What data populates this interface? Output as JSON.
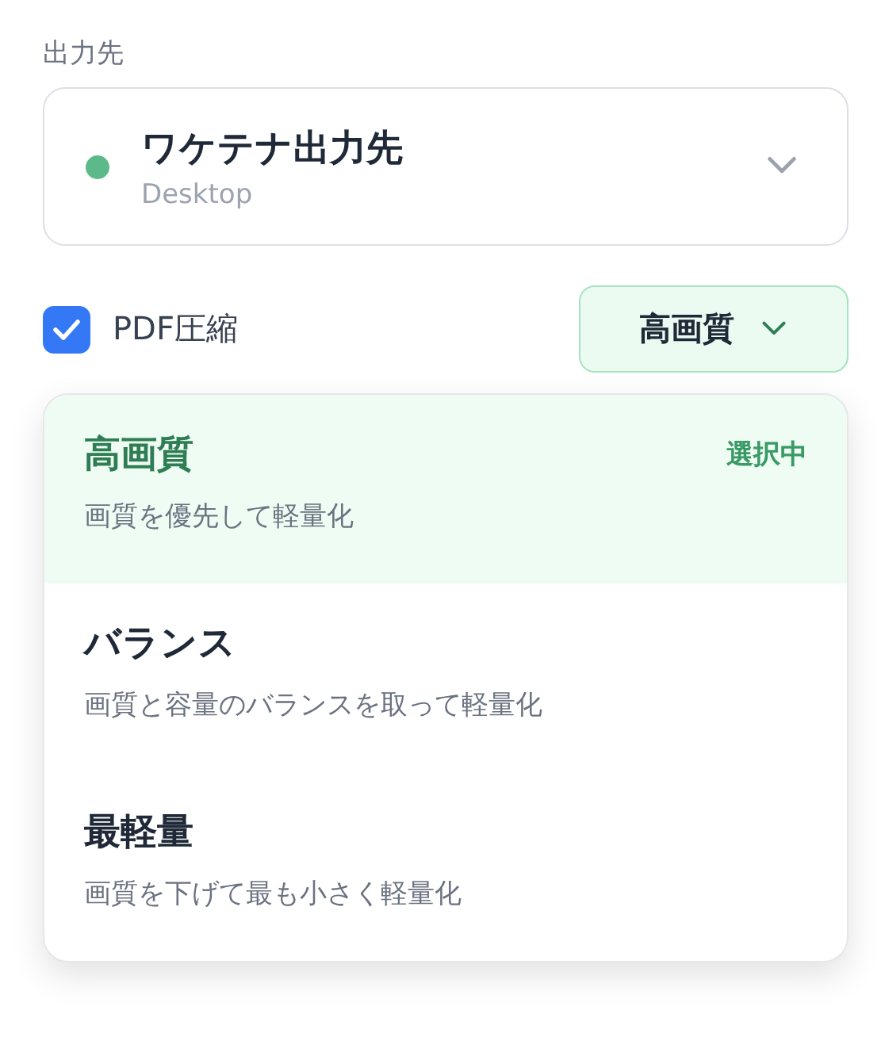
{
  "output": {
    "label": "出力先",
    "destination": {
      "name": "ワケテナ出力先",
      "path": "Desktop",
      "color": "#5bb98a"
    }
  },
  "compression": {
    "label": "PDF圧縮",
    "checked": true
  },
  "quality": {
    "value": "高画質",
    "expanded": true,
    "options": [
      {
        "title": "高画質",
        "description": "画質を優先して軽量化",
        "selected": true,
        "badge": "選択中"
      },
      {
        "title": "バランス",
        "description": "画質と容量のバランスを取って軽量化",
        "selected": false
      },
      {
        "title": "最軽量",
        "description": "画質を下げて最も小さく軽量化",
        "selected": false
      }
    ]
  }
}
